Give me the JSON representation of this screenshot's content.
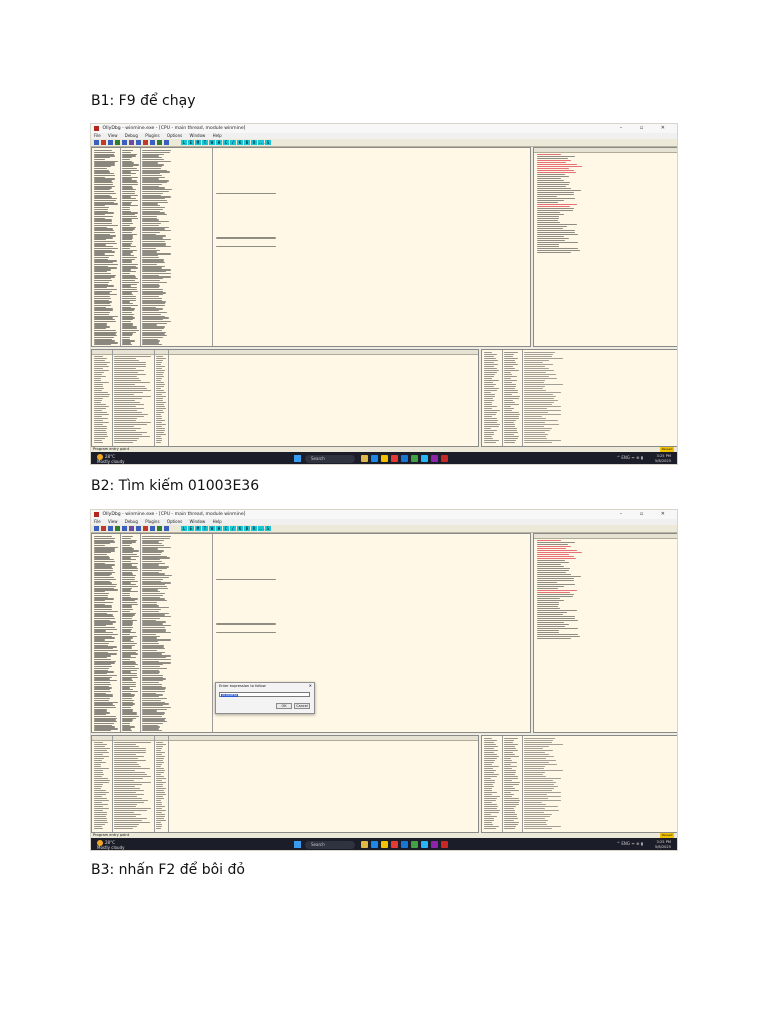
{
  "steps": [
    {
      "text": "B1: F9 để chạy"
    },
    {
      "text": "B2: Tìm kiếm 01003E36"
    },
    {
      "text": "B3: nhấn F2 để bôi đỏ"
    }
  ],
  "debugger": {
    "window_title": "OllyDbg - winmine.exe - [CPU - main thread, module winmine]",
    "window_buttons": "– ▫ ✕",
    "menu": [
      "File",
      "View",
      "Debug",
      "Plugins",
      "Options",
      "Window",
      "Help"
    ],
    "toolbar_letters": [
      "L",
      "E",
      "M",
      "T",
      "W",
      "H",
      "C",
      "/",
      "K",
      "B",
      "R",
      "...",
      "S"
    ],
    "status_text": "Program entry point",
    "status_state": "Paused",
    "colors": {
      "pane_background": "#fff8e6",
      "frame_background": "#efece2",
      "toolbar_letter_bg": "#19c6d4",
      "register_highlight": "#d0021b",
      "taskbar": "#1b1e28"
    }
  },
  "taskbar": {
    "weather_temp": "28°C",
    "weather_desc": "Mostly cloudy",
    "search_label": "Search",
    "tray_text": "^  ENG  ᯤ ⊕ ▮",
    "clock_time": "3:25 PM",
    "clock_date": "5/8/2025"
  },
  "goto_dialog": {
    "title": "Enter expression to follow",
    "close_glyph": "✕",
    "input_value": "01003E36",
    "ok_label": "OK",
    "cancel_label": "Cancel"
  }
}
